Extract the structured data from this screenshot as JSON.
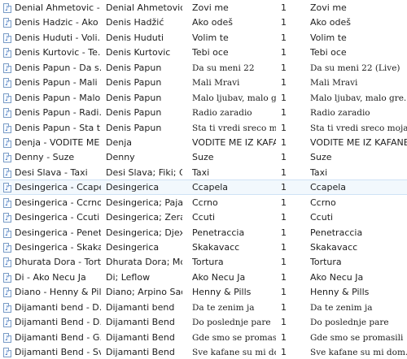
{
  "files": [
    {
      "name": "Denial Ahmetovic - ...",
      "artist": "Denial Ahmetovic;...",
      "title": "Zovi me",
      "track": "1",
      "album": "Zovi me"
    },
    {
      "name": "Denis Hadzic - Ako ...",
      "artist": "Denis Hadžić",
      "title": "Ako odeš",
      "track": "1",
      "album": "Ako odeš"
    },
    {
      "name": "Denis Huduti - Voli...",
      "artist": "Denis Huduti",
      "title": "Volim te",
      "track": "1",
      "album": "Volim te"
    },
    {
      "name": "Denis Kurtovic - Te...",
      "artist": "Denis Kurtovic",
      "title": "Tebi oce",
      "track": "1",
      "album": "Tebi oce"
    },
    {
      "name": "Denis Papun - Da s...",
      "artist": "Denis Papun",
      "title": "Da su meni 22",
      "track": "1",
      "album": "Da su meni 22 (Live)"
    },
    {
      "name": "Denis Papun - Mali ...",
      "artist": "Denis Papun",
      "title": "Mali Mravi",
      "track": "1",
      "album": "Mali Mravi"
    },
    {
      "name": "Denis Papun - Malo...",
      "artist": "Denis Papun",
      "title": "Malo ljubav, malo g...",
      "track": "1",
      "album": "Malo ljubav, malo gre..."
    },
    {
      "name": "Denis Papun - Radi...",
      "artist": "Denis Papun",
      "title": "Radio zaradio",
      "track": "1",
      "album": "Radio zaradio"
    },
    {
      "name": "Denis Papun - Sta ti...",
      "artist": "Denis Papun",
      "title": "Sta ti vredi sreco m...",
      "track": "1",
      "album": "Sta ti vredi sreco moja"
    },
    {
      "name": "Denja - VODITE ME ...",
      "artist": "Denja",
      "title": "VODITE ME IZ KAFAN...",
      "track": "1",
      "album": "VODITE ME IZ KAFANE"
    },
    {
      "name": "Denny - Suze",
      "artist": "Denny",
      "title": "Suze",
      "track": "1",
      "album": "Suze"
    },
    {
      "name": "Desi Slava - Taxi",
      "artist": "Desi Slava; Fiki; Ga...",
      "title": "Taxi",
      "track": "1",
      "album": "Taxi"
    },
    {
      "name": "Desingerica - Ccapela",
      "artist": "Desingerica",
      "title": "Ccapela",
      "track": "1",
      "album": "Ccapela"
    },
    {
      "name": "Desingerica - Ccrno",
      "artist": "Desingerica; Pajak...",
      "title": "Ccrno",
      "track": "1",
      "album": "Ccrno"
    },
    {
      "name": "Desingerica - Ccuti",
      "artist": "Desingerica; Zera",
      "title": "Ccuti",
      "track": "1",
      "album": "Ccuti"
    },
    {
      "name": "Desingerica - Penet...",
      "artist": "Desingerica; Djexon",
      "title": "Penetraccia",
      "track": "1",
      "album": "Penetraccia"
    },
    {
      "name": "Desingerica - Skaka...",
      "artist": "Desingerica",
      "title": "Skakavacc",
      "track": "1",
      "album": "Skakavacc"
    },
    {
      "name": "Dhurata Dora - Tort...",
      "artist": "Dhurata Dora; Mc ...",
      "title": "Tortura",
      "track": "1",
      "album": "Tortura"
    },
    {
      "name": "Di - Ako Necu Ja",
      "artist": "Di; Leflow",
      "title": "Ako Necu Ja",
      "track": "1",
      "album": "Ako Necu Ja"
    },
    {
      "name": "Diano - Henny & Pills",
      "artist": "Diano; Arpino Sachi",
      "title": "Henny & Pills",
      "track": "1",
      "album": "Henny & Pills"
    },
    {
      "name": "Dijamanti bend - D...",
      "artist": "Dijamanti bend",
      "title": "Da te zenim ja",
      "track": "1",
      "album": "Da te zenim ja"
    },
    {
      "name": "Dijamanti Bend - D...",
      "artist": "Dijamanti Bend",
      "title": "Do poslednje pare",
      "track": "1",
      "album": "Do poslednje pare"
    },
    {
      "name": "Dijamanti Bend - G...",
      "artist": "Dijamanti Bend",
      "title": "Gde smo se promasili",
      "track": "1",
      "album": "Gde smo se promasili"
    },
    {
      "name": "Dijamanti Bend - Sv...",
      "artist": "Dijamanti Bend",
      "title": "Sve kafane su mi do...",
      "track": "1",
      "album": "Sve kafane su mi dom..."
    }
  ],
  "selected_index": 12,
  "serif_titles": [
    4,
    5,
    6,
    7,
    8,
    20,
    21,
    22,
    23
  ],
  "colors": {
    "selection_bg": "#f2f8fd",
    "selection_border": "#cfe2f6",
    "icon_blue": "#2b61b8"
  },
  "row_icon": "audio-file-icon"
}
